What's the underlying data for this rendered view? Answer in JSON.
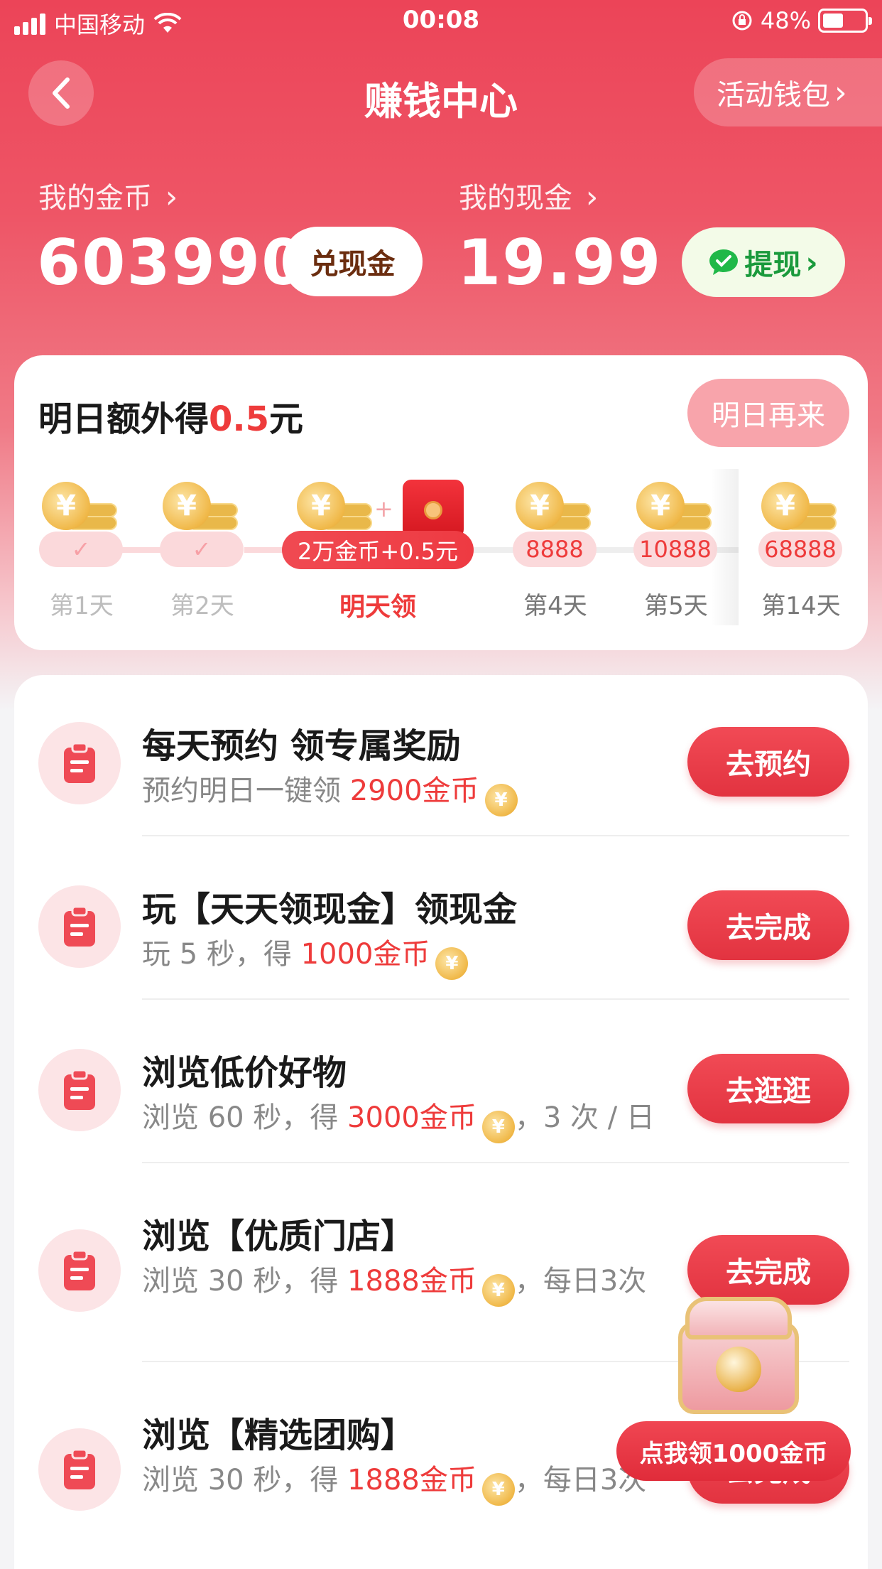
{
  "status_bar": {
    "carrier": "中国移动",
    "time": "00:08",
    "battery": "48%"
  },
  "nav": {
    "title": "赚钱中心",
    "wallet_label": "活动钱包",
    "wallet_chevron": "›"
  },
  "coins": {
    "label": "我的金币",
    "chevron": "›",
    "value": "603990",
    "action": "兑现金"
  },
  "cash": {
    "label": "我的现金",
    "chevron": "›",
    "value": "19.99",
    "action": "提现",
    "action_chevron": "›"
  },
  "checkin": {
    "title_prefix": "明日额外得",
    "title_amount": "0.5",
    "title_suffix": "元",
    "action": "明日再来",
    "plus": "+",
    "days": [
      {
        "pill": "✓",
        "label": "第1天",
        "state": "done"
      },
      {
        "pill": "✓",
        "label": "第2天",
        "state": "done"
      },
      {
        "pill": "2万金币+0.5元",
        "label": "明天领",
        "state": "tomorrow"
      },
      {
        "pill": "8888",
        "label": "第4天",
        "state": "future"
      },
      {
        "pill": "10888",
        "label": "第5天",
        "state": "future"
      },
      {
        "pill": "68888",
        "label": "第14天",
        "state": "future"
      }
    ]
  },
  "coin_glyph": "¥",
  "tasks": [
    {
      "title": "每天预约 领专属奖励",
      "sub_prefix": "预约明日一键领 ",
      "reward": "2900金币",
      "sub_suffix": "",
      "button": "去预约"
    },
    {
      "title": "玩【天天领现金】领现金",
      "sub_prefix": "玩 5 秒，得 ",
      "reward": "1000金币",
      "sub_suffix": "",
      "button": "去完成"
    },
    {
      "title": "浏览低价好物",
      "sub_prefix": "浏览 60 秒，得 ",
      "reward": "3000金币",
      "sub_suffix": "，3 次 / 日",
      "button": "去逛逛"
    },
    {
      "title": "浏览【优质门店】",
      "sub_prefix": "浏览 30 秒，得 ",
      "reward": "1888金币",
      "sub_suffix": "，每日3次",
      "button": "去完成"
    },
    {
      "title": "浏览【精选团购】",
      "sub_prefix": "浏览 30 秒，得 ",
      "reward": "1888金币",
      "sub_suffix": "，每日3次",
      "button": "去完成"
    }
  ],
  "floating": {
    "label": "点我领1000金币"
  },
  "colors": {
    "brand_red": "#ee3b3b",
    "header_red": "#ec4458",
    "wechat_green": "#20b848"
  },
  "icons": {
    "back": "chevron-left-icon",
    "task": "clipboard-icon",
    "withdraw": "wechat-icon",
    "chest": "treasure-chest-icon"
  }
}
